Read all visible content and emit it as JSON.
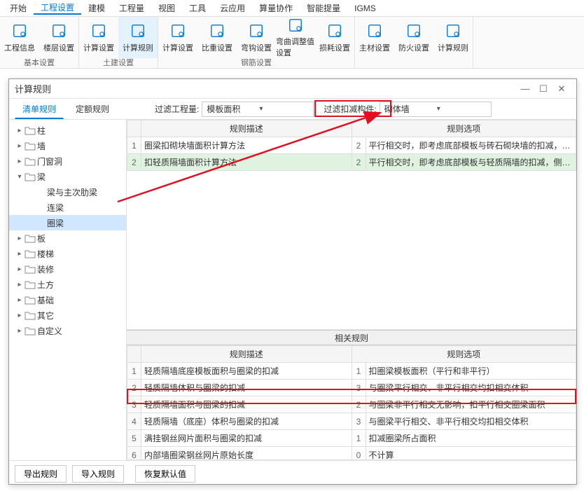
{
  "menu": [
    "开始",
    "工程设置",
    "建模",
    "工程量",
    "视图",
    "工具",
    "云应用",
    "算量协作",
    "智能提量",
    "IGMS"
  ],
  "menu_active": 1,
  "ribbon": {
    "groups": [
      {
        "label": "基本设置",
        "items": [
          {
            "name": "proj-info",
            "label": "工程信息"
          },
          {
            "name": "floor-set",
            "label": "楼层设置"
          }
        ]
      },
      {
        "label": "土建设置",
        "items": [
          {
            "name": "calc-set",
            "label": "计算设置"
          },
          {
            "name": "calc-rule",
            "label": "计算规则",
            "sel": true
          }
        ]
      },
      {
        "label": "钢筋设置",
        "items": [
          {
            "name": "calc-set2",
            "label": "计算设置"
          },
          {
            "name": "ratio-set",
            "label": "比重设置"
          },
          {
            "name": "hook-set",
            "label": "弯钩设置"
          },
          {
            "name": "bend-adj",
            "label": "弯曲调整值设置"
          },
          {
            "name": "loss-set",
            "label": "损耗设置"
          }
        ]
      },
      {
        "label": "",
        "items": [
          {
            "name": "main-mat",
            "label": "主材设置"
          },
          {
            "name": "fire-set",
            "label": "防火设置"
          },
          {
            "name": "calc-rule2",
            "label": "计算规则"
          }
        ]
      }
    ]
  },
  "dialog": {
    "title": "计算规则",
    "tabs": [
      "清单规则",
      "定额规则"
    ],
    "tab_active": 0,
    "filter1_label": "过滤工程量:",
    "filter1_value": "模板面积",
    "filter2_label": "过滤扣减构件:",
    "filter2_value": "砌体墙",
    "tree": [
      {
        "l": 1,
        "exp": "▸",
        "label": "柱"
      },
      {
        "l": 1,
        "exp": "▸",
        "label": "墙"
      },
      {
        "l": 1,
        "exp": "▸",
        "label": "门窗洞"
      },
      {
        "l": 1,
        "exp": "▾",
        "label": "梁"
      },
      {
        "l": 2,
        "label": "梁与主次肋梁"
      },
      {
        "l": 2,
        "label": "连梁"
      },
      {
        "l": 2,
        "label": "圈梁",
        "sel": true
      },
      {
        "l": 1,
        "exp": "▸",
        "label": "板"
      },
      {
        "l": 1,
        "exp": "▸",
        "label": "楼梯"
      },
      {
        "l": 1,
        "exp": "▸",
        "label": "装修"
      },
      {
        "l": 1,
        "exp": "▸",
        "label": "土方"
      },
      {
        "l": 1,
        "exp": "▸",
        "label": "基础"
      },
      {
        "l": 1,
        "exp": "▸",
        "label": "其它"
      },
      {
        "l": 1,
        "exp": "▸",
        "label": "自定义"
      }
    ],
    "top_headers": [
      "规则描述",
      "规则选项"
    ],
    "top_rows": [
      {
        "n": "1",
        "desc": "圈梁扣砌块墙面积计算方法",
        "optn": "2",
        "opt": "平行相交时，即考虑底部模板与砖石砌块墙的扣减，侧面…"
      },
      {
        "n": "2",
        "desc": "扣轻质隔墙面积计算方法",
        "optn": "2",
        "opt": "平行相交时，即考虑底部模板与轻质隔墙的扣减，侧面如…",
        "hl": true
      }
    ],
    "related_title": "相关规则",
    "rel_headers": [
      "规则描述",
      "规则选项"
    ],
    "rel_rows": [
      {
        "n": "1",
        "desc": "轻质隔墙底座模板面积与圈梁的扣减",
        "optn": "1",
        "opt": "扣圈梁模板面积（平行和非平行）"
      },
      {
        "n": "2",
        "desc": "轻质隔墙体积与圈梁的扣减",
        "optn": "3",
        "opt": "与圈梁平行相交、非平行相交均扣相交体积"
      },
      {
        "n": "3",
        "desc": "轻质隔墙面积与圈梁的扣减",
        "optn": "2",
        "opt": "与圈梁非平行相交无影响，扣平行相交圈梁面积",
        "mark": true
      },
      {
        "n": "4",
        "desc": "轻质隔墙（底座）体积与圈梁的扣减",
        "optn": "3",
        "opt": "与圈梁平行相交、非平行相交均扣相交体积"
      },
      {
        "n": "5",
        "desc": "满挂钢丝网片面积与圈梁的扣减",
        "optn": "1",
        "opt": "扣减圈梁所占面积"
      },
      {
        "n": "6",
        "desc": "内部墙圈梁钢丝网片原始长度",
        "optn": "0",
        "opt": "不计算"
      }
    ],
    "footer": [
      "导出规则",
      "导入规则",
      "恢复默认值"
    ]
  }
}
